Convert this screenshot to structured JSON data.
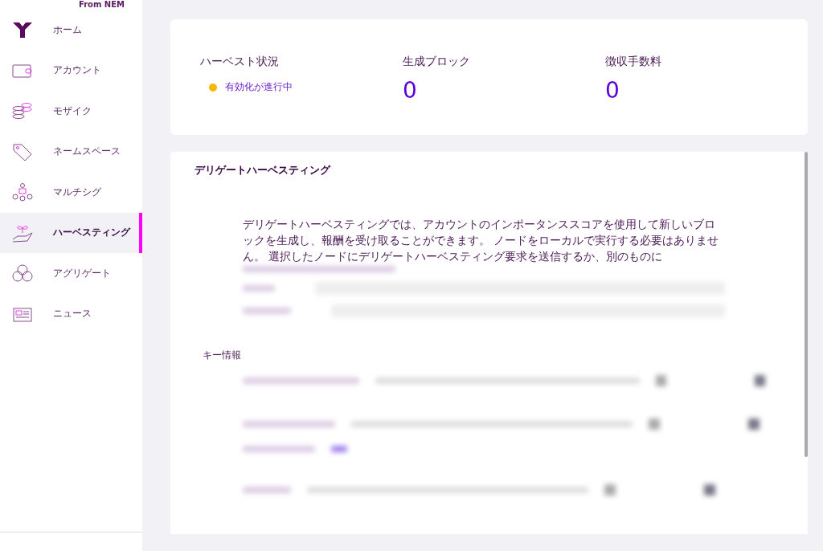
{
  "sidebar": {
    "brand_caption": "From NEM",
    "items": [
      {
        "label": "ホーム",
        "kind": "home",
        "selected": false
      },
      {
        "label": "アカウント",
        "kind": "wallet",
        "selected": false
      },
      {
        "label": "モザイク",
        "kind": "coins",
        "selected": false
      },
      {
        "label": "ネームスペース",
        "kind": "tag",
        "selected": false
      },
      {
        "label": "マルチシグ",
        "kind": "people",
        "selected": false
      },
      {
        "label": "ハーベスティング",
        "kind": "plant",
        "selected": true
      },
      {
        "label": "アグリゲート",
        "kind": "circles",
        "selected": false
      },
      {
        "label": "ニュース",
        "kind": "news",
        "selected": false
      }
    ]
  },
  "stats": [
    {
      "label": "ハーベスト状況",
      "kind": "status",
      "value": "有効化が進行中",
      "color": "#f5b800"
    },
    {
      "label": "生成ブロック",
      "kind": "number",
      "value": "0"
    },
    {
      "label": "徴収手数料",
      "kind": "number",
      "value": "0"
    }
  ],
  "delegated": {
    "title": "デリゲートハーベスティング",
    "description": "デリゲートハーベスティングでは、アカウントのインポータンススコアを使用して新しいブロックを生成し、報酬を受け取ることができます。 ノードをローカルで実行する必要はありません。 選択したノードにデリゲートハーベスティング要求を送信するか、別のものに",
    "key_info_label": "キー情報"
  }
}
